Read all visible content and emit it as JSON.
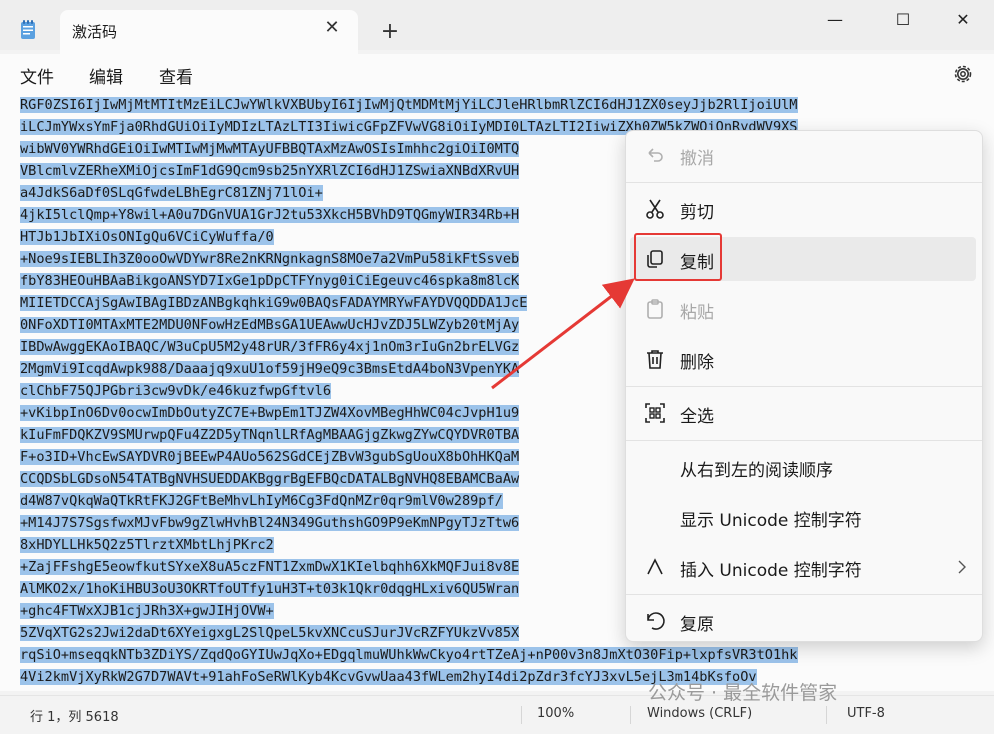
{
  "window": {
    "tab_title": "激活码",
    "tab_close": "✕",
    "new_tab": "+",
    "minimize": "—",
    "maximize": "☐",
    "close": "✕"
  },
  "menu": {
    "file": "文件",
    "edit": "编辑",
    "view": "查看"
  },
  "editor": {
    "lines": [
      "RGF0ZSI6IjIwMjMtMTItMzEiLCJwYWlkVXBUbyI6IjIwMjQtMDMtMjYiLCJleHRlbmRlZCI6dHJ1ZX0seyJjb2RlIjoiUlM",
      "iLCJmYWxsYmFja0RhdGUiOiIyMDIzLTAzLTI3IiwicGFpZFVwVG8iOiIyMDI0LTAzLTI2IiwiZXh0ZW5kZWQiOnRydWV9XS",
      "wibWV0YWRhdGEiOiIwMTIwMjMwMTAyUFBBQTAxMzAwOSIsImhhc2giOiI0MTQ",
      "VBlcmlvZERheXMiOjcsImF1dG9Qcm9sb25nYXRlZCI6dHJ1ZSwiaXNBdXRvUH",
      "a4JdkS6aDf0SLqGfwdeLBhEgrC81ZNj71lOi+",
      "4jkI5lclQmp+Y8wil+A0u7DGnVUA1GrJ2tu53XkcH5BVhD9TQGmyWIR34Rb+H",
      "HTJb1JbIXiOsONIgQu6VCiCyWuffa/0",
      "+Noe9sIEBLIh3Z0ooOwVDYwr8Re2nKRNgnkagnS8MOe7a2VmPu58ikFtSsveb",
      "fbY83HEOuHBAaBikgoANSYD7IxGe1pDpCTFYnyg0iCiEgeuvc46spka8m8lcK",
      "MIIETDCCAjSgAwIBAgIBDzANBgkqhkiG9w0BAQsFADAYMRYwFAYDVQQDDA1JcE",
      "0NFoXDTI0MTAxMTE2MDU0NFowHzEdMBsGA1UEAwwUcHJvZDJ5LWZyb20tMjAy",
      "IBDwAwggEKAoIBAQC/W3uCpU5M2y48rUR/3fFR6y4xj1nOm3rIuGn2brELVGz",
      "2MgmVi9IcqdAwpk988/Daaajq9xuU1of59jH9eQ9c3BmsEtdA4boN3VpenYKA",
      "clChbF75QJPGbri3cw9vDk/e46kuzfwpGftvl6",
      "+vKibpInO6Dv0ocwImDbOutyZC7E+BwpEm1TJZW4XovMBegHhWC04cJvpH1u9",
      "kIuFmFDQKZV9SMUrwpQFu4Z2D5yTNqnlLRfAgMBAAGjgZkwgZYwCQYDVR0TBA",
      "F+o3ID+VhcEwSAYDVR0jBEEwP4AUo562SGdCEjZBvW3gubSgUouX8bOhHKQaM",
      "CCQDSbLGDsoN54TATBgNVHSUEDDAKBggrBgEFBQcDATALBgNVHQ8EBAMCBaAw",
      "d4W87vQkqWaQTkRtFKJ2GFtBeMhvLhIyM6Cg3FdQnMZr0qr9mlV0w289pf/",
      "+M14J7S7SgsfwxMJvFbw9gZlwHvhBl24N349GuthshGO9P9eKmNPgyTJzTtw6",
      "8xHDYLLHk5Q2z5TlrztXMbtLhjPKrc2",
      "+ZajFFshgE5eowfkutSYxeX8uA5czFNT1ZxmDwX1KIelbqhh6XkMQFJui8v8E",
      "AlMKO2x/1hoKiHBU3oU3OKRTfoUTfy1uH3T+t03k1Qkr0dqgHLxiv6QU5Wran",
      "+ghc4FTWxXJB1cjJRh3X+gwJIHjOVW+",
      "5ZVqXTG2s2Jwi2daDt6XYeigxgL2SlQpeL5kvXNCcuSJurJVcRZFYUkzVv85X",
      "rqSiO+mseqqkNTb3ZDiYS/ZqdQoGYIUwJqXo+EDgqlmuWUhkWwCkyo4rtTZeAj+nP00v3n8JmXtO30Fip+lxpfsVR3tO1hk",
      "4Vi2kmVjXyRkW2G7D7WAVt+91ahFoSeRWlKyb4KcvGvwUaa43fWLem2hyI4di2pZdr3fcYJ3xvL5ejL3m14bKsfoOv"
    ]
  },
  "status": {
    "position": "行 1，列 5618",
    "zoom": "100%",
    "line_ending": "Windows (CRLF)",
    "encoding": "UTF-8"
  },
  "context_menu": {
    "undo": "撤消",
    "cut": "剪切",
    "copy": "复制",
    "paste": "粘贴",
    "delete": "删除",
    "select_all": "全选",
    "rtl": "从右到左的阅读顺序",
    "show_unicode": "显示 Unicode 控制字符",
    "insert_unicode": "插入 Unicode 控制字符",
    "reconvert": "复原"
  },
  "watermark": "公众号 · 最全软件管家",
  "colors": {
    "selection": "#9cc3ea",
    "annotation": "#e53935"
  }
}
